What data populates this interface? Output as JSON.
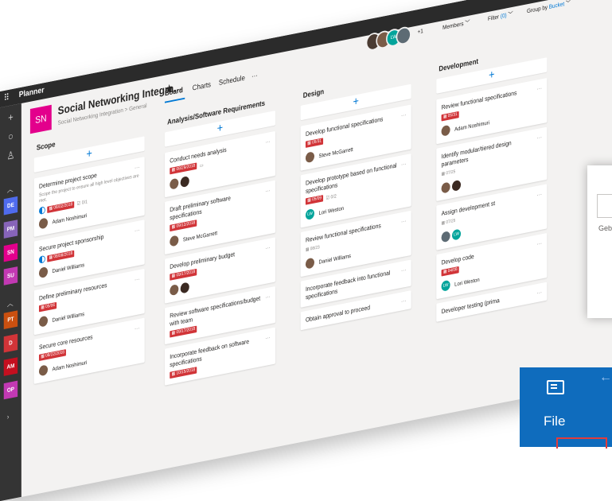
{
  "colors": {
    "accent": "#0078d4",
    "plan_logo": "#e3008c",
    "overdue": "#d13438",
    "rail": "#343434",
    "file_tile": "#0f6cbd"
  },
  "titlebar": {
    "app_name": "Planner",
    "icons": [
      "waffle-icon",
      "bell-icon",
      "gear-icon",
      "help-icon"
    ],
    "help": "?"
  },
  "rail": {
    "icons": [
      "plus-icon",
      "circle-icon",
      "person-icon"
    ],
    "plans": [
      {
        "label": "DE",
        "color": "#4f6bed"
      },
      {
        "label": "PM",
        "color": "#8764b8"
      },
      {
        "label": "SN",
        "color": "#e3008c"
      },
      {
        "label": "SU",
        "color": "#c239b3"
      },
      {
        "label": "PT",
        "color": "#ca5010"
      },
      {
        "label": "D",
        "color": "#d13438"
      },
      {
        "label": "AM",
        "color": "#c50f1f"
      },
      {
        "label": "OP",
        "color": "#c239b3"
      }
    ]
  },
  "plan": {
    "logo": "SN",
    "title": "Social Networking Integra...",
    "star": "★",
    "breadcrumb": "Social Networking Integration > General"
  },
  "nav": {
    "tabs": [
      "Board",
      "Charts",
      "Schedule"
    ],
    "more": "···",
    "active": "Board"
  },
  "header": {
    "member_extra": "+1",
    "members_label": "Members",
    "filter_label": "Filter",
    "filter_count": "(0)",
    "group_label": "Group by",
    "group_value": "Bucket",
    "member_avatars": [
      {
        "initials": "",
        "color": "#4a3b32"
      },
      {
        "initials": "",
        "color": "#7a5c48"
      },
      {
        "initials": "LW",
        "color": "#03a49b"
      },
      {
        "initials": "",
        "color": "#5d6b74"
      }
    ]
  },
  "buckets": [
    {
      "title": "Scope",
      "add": "+",
      "cards": [
        {
          "title": "Determine project scope",
          "desc": "Scope the project to ensure all high level objectives are met.",
          "date": "08/02/2018",
          "checklist": "0/1",
          "progress": true,
          "assignee": "Adam Noshimuri"
        },
        {
          "title": "Secure project sponsorship",
          "date": "08/08/2018",
          "progress": true,
          "assignee": "Daniel Williams"
        },
        {
          "title": "Define preliminary resources",
          "date": "05/06",
          "assignee": "Daniel Williams"
        },
        {
          "title": "Secure core resources",
          "date": "08/22/2018",
          "assignee": "Adam Noshimuri"
        }
      ]
    },
    {
      "title": "Analysis/Software Requirements",
      "add": "+",
      "cards": [
        {
          "title": "Conduct needs analysis",
          "date": "08/29/2018",
          "comment": true,
          "avatars": 2
        },
        {
          "title": "Draft preliminary software specifications",
          "date": "09/12/2018",
          "assignee": "Steve McGarrett"
        },
        {
          "title": "Develop preliminary budget",
          "date": "09/17/2018",
          "avatars": 2
        },
        {
          "title": "Review software specifications/budget with team",
          "date": "09/17/2018"
        },
        {
          "title": "Incorporate feedback on software specifications",
          "date": "10/15/2018"
        }
      ]
    },
    {
      "title": "Design",
      "add": "+",
      "cards": [
        {
          "title": "Develop functional specifications",
          "date": "05/31",
          "assignee": "Steve McGarrett"
        },
        {
          "title": "Develop prototype based on functional specifications",
          "date": "05/09",
          "checklist": "0/2",
          "assignee": "Lori Weston",
          "assignee_initials": "LW"
        },
        {
          "title": "Review functional specifications",
          "date": "08/23",
          "date_grey": true,
          "assignee": "Daniel Williams"
        },
        {
          "title": "Incorporate feedback into functional specifications"
        },
        {
          "title": "Obtain approval to proceed"
        }
      ]
    },
    {
      "title": "Development",
      "add": "+",
      "cards": [
        {
          "title": "Review functional specifications",
          "date": "05/31",
          "assignee": "Adam Noshimuri"
        },
        {
          "title": "Identify modular/tiered design parameters",
          "date": "07/25",
          "date_grey": true,
          "avatars": 2
        },
        {
          "title": "Assign development st",
          "date": "07/25",
          "date_grey": true,
          "avatars_lw": true
        },
        {
          "title": "Develop code",
          "date": "04/08",
          "assignee": "Lori Weston",
          "assignee_initials": "LW"
        },
        {
          "title": "Developer testing (prima"
        }
      ]
    }
  ],
  "overlay": {
    "label": "Geba"
  },
  "file_tile": {
    "label": "File",
    "icon": "file-icon",
    "arrow": "←"
  }
}
